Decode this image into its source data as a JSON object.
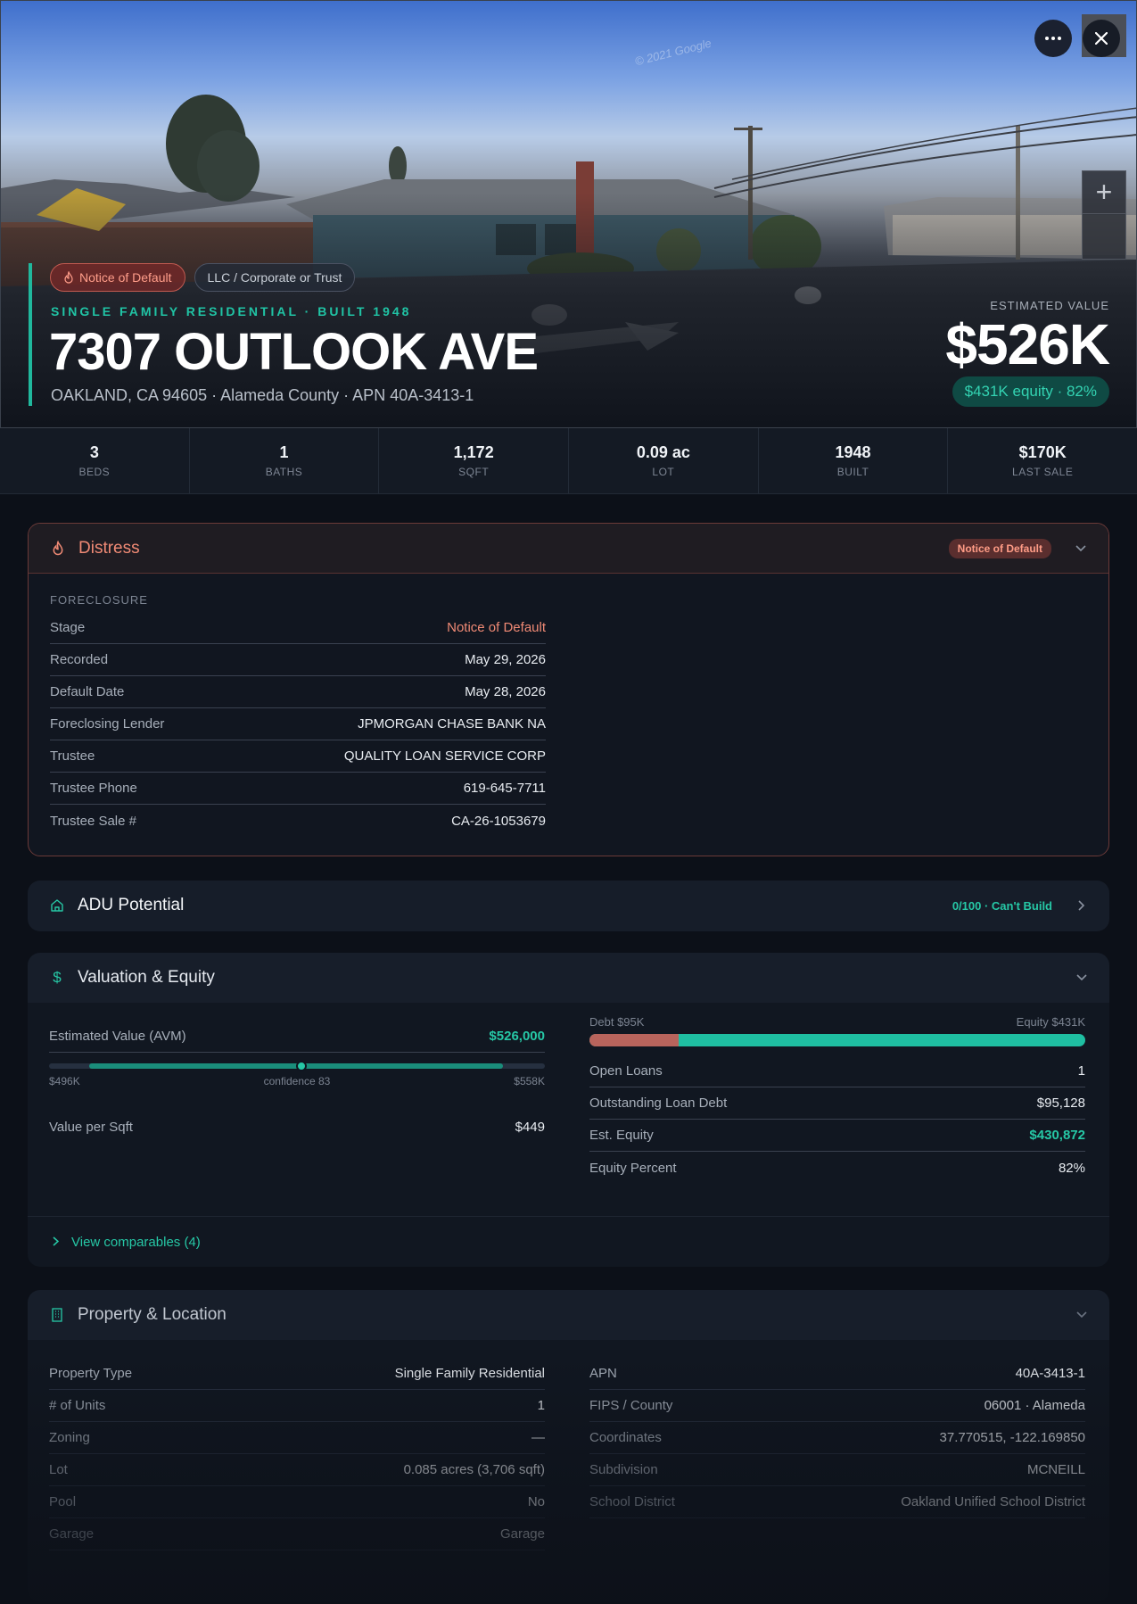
{
  "hero": {
    "watermark": "© 2021 Google",
    "chips": [
      "Notice of Default",
      "LLC / Corporate or Trust"
    ],
    "meta": "SINGLE FAMILY RESIDENTIAL · BUILT 1948",
    "title": "7307 OUTLOOK AVE",
    "subtitle": "OAKLAND, CA 94605 · Alameda County · APN 40A-3413-1",
    "est_label": "ESTIMATED VALUE",
    "est_value": "$526K",
    "equity_pill": "$431K equity · 82%",
    "icons": [
      "more-icon",
      "close-icon",
      "zoom-in-icon",
      "flame-icon"
    ]
  },
  "stats": [
    {
      "value": "3",
      "label": "BEDS"
    },
    {
      "value": "1",
      "label": "BATHS"
    },
    {
      "value": "1,172",
      "label": "SQFT"
    },
    {
      "value": "0.09 ac",
      "label": "LOT"
    },
    {
      "value": "1948",
      "label": "BUILT"
    },
    {
      "value": "$170K",
      "label": "LAST SALE"
    }
  ],
  "distress": {
    "title": "Distress",
    "badge": "Notice of Default",
    "section": "FORECLOSURE",
    "rows": [
      {
        "k": "Stage",
        "v": "Notice of Default"
      },
      {
        "k": "Recorded",
        "v": "May 29, 2026"
      },
      {
        "k": "Default Date",
        "v": "May 28, 2026"
      },
      {
        "k": "Foreclosing Lender",
        "v": "JPMORGAN CHASE BANK NA"
      },
      {
        "k": "Trustee",
        "v": "QUALITY LOAN SERVICE CORP"
      },
      {
        "k": "Trustee Phone",
        "v": "619-645-7711"
      },
      {
        "k": "Trustee Sale #",
        "v": "CA-26-1053679"
      }
    ]
  },
  "adu": {
    "title": "ADU Potential",
    "tag": "0/100 · Can't Build"
  },
  "valuation": {
    "title": "Valuation & Equity",
    "avm_label": "Estimated Value (AVM)",
    "avm_value": "$526,000",
    "range_low": "$496K",
    "range_mid": "confidence 83",
    "range_high": "$558K",
    "vps_label": "Value per Sqft",
    "vps_value": "$449",
    "debt_label": "Debt $95K",
    "equity_label": "Equity $431K",
    "debt_fraction": 0.18,
    "rows": [
      {
        "k": "Open Loans",
        "v": "1"
      },
      {
        "k": "Outstanding Loan Debt",
        "v": "$95,128"
      },
      {
        "k": "Est. Equity",
        "v": "$430,872"
      },
      {
        "k": "Equity Percent",
        "v": "82%"
      }
    ],
    "comps": "View comparables (4)"
  },
  "property": {
    "title": "Property & Location",
    "left": [
      {
        "k": "Property Type",
        "v": "Single Family Residential"
      },
      {
        "k": "# of Units",
        "v": "1"
      },
      {
        "k": "Zoning",
        "v": "—"
      },
      {
        "k": "Lot",
        "v": "0.085 acres (3,706 sqft)"
      },
      {
        "k": "Pool",
        "v": "No"
      },
      {
        "k": "Garage",
        "v": "Garage"
      }
    ],
    "right": [
      {
        "k": "APN",
        "v": "40A-3413-1"
      },
      {
        "k": "FIPS / County",
        "v": "06001 · Alameda"
      },
      {
        "k": "Coordinates",
        "v": "37.770515, -122.169850"
      },
      {
        "k": "Subdivision",
        "v": "MCNEILL"
      },
      {
        "k": "School District",
        "v": "Oakland Unified School District"
      }
    ]
  },
  "colors": {
    "accent": "#20b89d",
    "danger": "#f08a75",
    "debt": "#b8645c"
  }
}
